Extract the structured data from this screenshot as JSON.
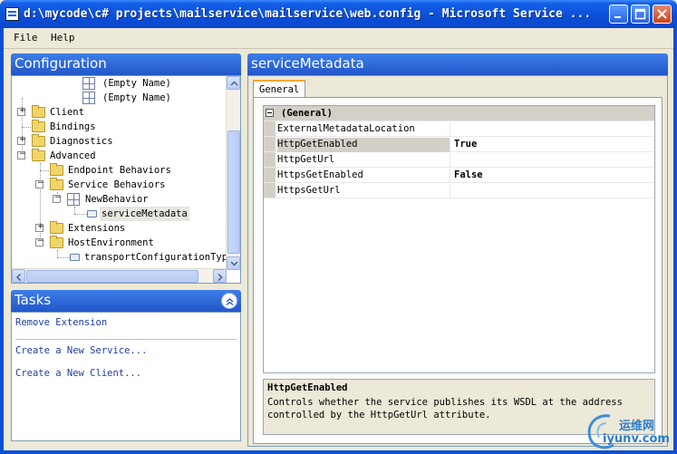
{
  "window": {
    "title": "d:\\mycode\\c# projects\\mailservice\\mailservice\\web.config - Microsoft Service ..."
  },
  "menu": {
    "file": "File",
    "help": "Help"
  },
  "config_panel": {
    "title": "Configuration",
    "tree": [
      {
        "label": "(Empty Name)"
      },
      {
        "label": "(Empty Name)"
      },
      {
        "label": "Client",
        "expander": "+"
      },
      {
        "label": "Bindings"
      },
      {
        "label": "Diagnostics",
        "expander": "+"
      },
      {
        "label": "Advanced",
        "expander": "−"
      },
      {
        "label": "Endpoint Behaviors"
      },
      {
        "label": "Service Behaviors",
        "expander": "−"
      },
      {
        "label": "NewBehavior",
        "expander": "−"
      },
      {
        "label": "serviceMetadata"
      },
      {
        "label": "Extensions",
        "expander": "+"
      },
      {
        "label": "HostEnvironment",
        "expander": "−"
      },
      {
        "label": "transportConfigurationType"
      }
    ]
  },
  "tasks_panel": {
    "title": "Tasks",
    "links": [
      "Remove Extension",
      "Create a New Service...",
      "Create a New Client..."
    ]
  },
  "detail_panel": {
    "title": "serviceMetadata",
    "tab": "General",
    "category": "(General)",
    "properties": [
      {
        "name": "ExternalMetadataLocation",
        "value": ""
      },
      {
        "name": "HttpGetEnabled",
        "value": "True"
      },
      {
        "name": "HttpGetUrl",
        "value": ""
      },
      {
        "name": "HttpsGetEnabled",
        "value": "False"
      },
      {
        "name": "HttpsGetUrl",
        "value": ""
      }
    ],
    "description": {
      "title": "HttpGetEnabled",
      "body": "Controls whether the service publishes its WSDL at the address\ncontrolled by the HttpGetUrl attribute."
    }
  },
  "watermark": {
    "line1": "运维网",
    "line2": "iyunv.com"
  }
}
